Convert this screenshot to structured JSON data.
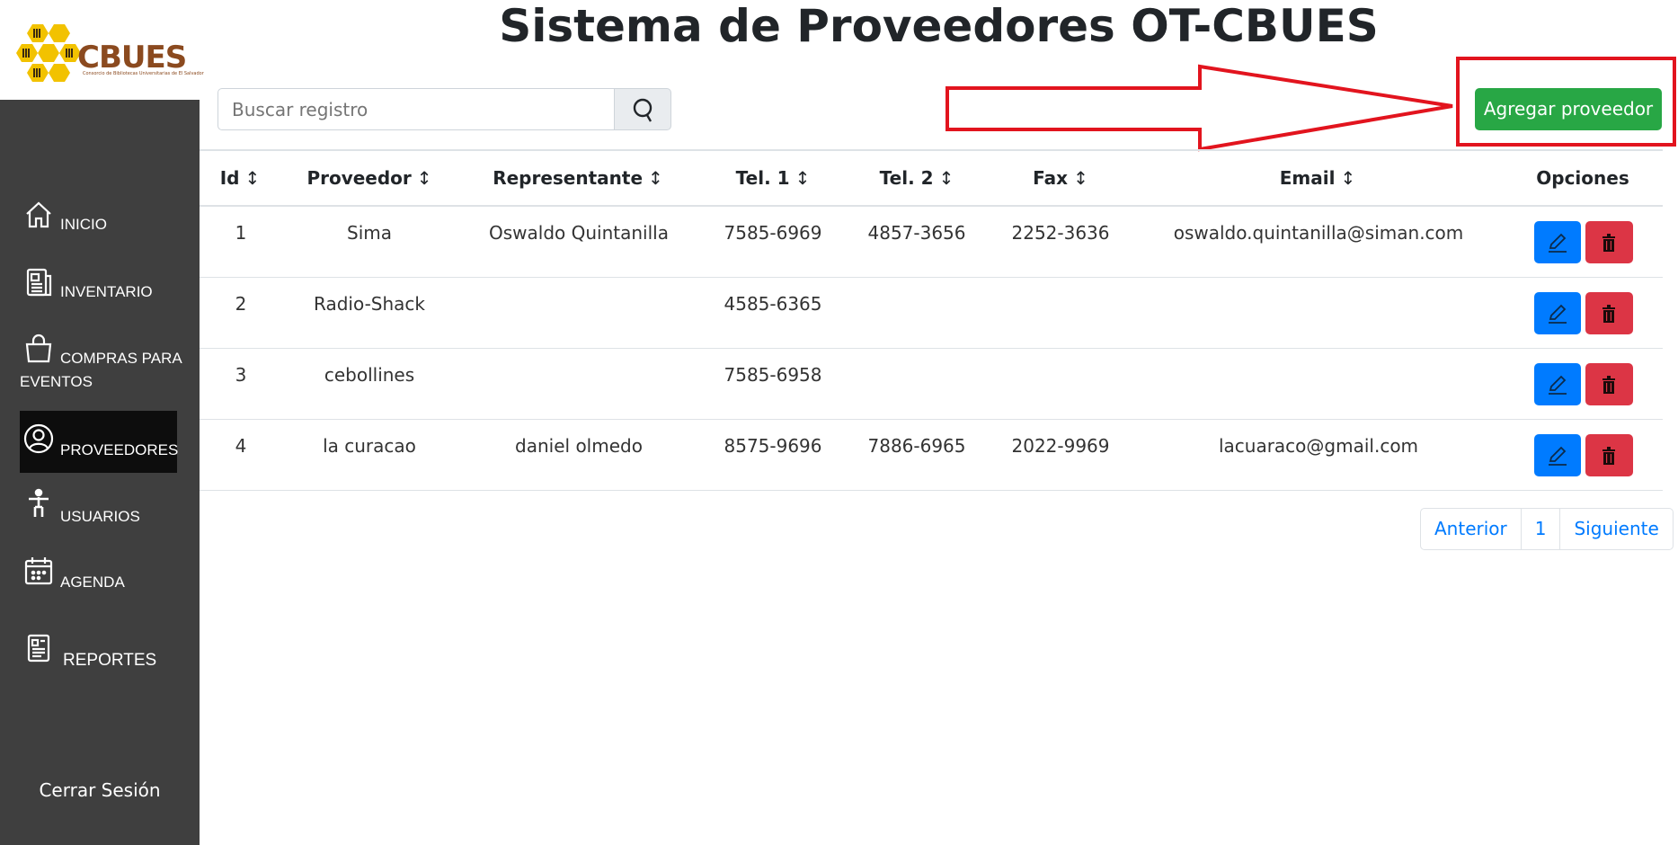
{
  "brand": {
    "logo_text": "CBUES",
    "logo_subtitle": "Consorcio de Bibliotecas Universitarias de El Salvador"
  },
  "header": {
    "title": "Sistema de Proveedores OT-CBUES"
  },
  "sidebar": {
    "items": [
      {
        "label": "INICIO",
        "icon": "home-icon"
      },
      {
        "label": "INVENTARIO",
        "icon": "newspaper-icon"
      },
      {
        "label_line1": "COMPRAS PARA",
        "label_line2": "EVENTOS",
        "icon": "shopping-bag-icon"
      },
      {
        "label": "PROVEEDORES",
        "icon": "user-circle-icon",
        "active": true
      },
      {
        "label": "USUARIOS",
        "icon": "person-icon"
      },
      {
        "label": "AGENDA",
        "icon": "calendar-icon"
      },
      {
        "label": "REPORTES",
        "icon": "report-icon"
      }
    ],
    "logout_label": "Cerrar Sesión"
  },
  "search": {
    "placeholder": "Buscar registro",
    "icon": "search-icon"
  },
  "actions": {
    "add_label": "Agregar proveedor"
  },
  "table": {
    "headers": [
      "Id",
      "Proveedor",
      "Representante",
      "Tel. 1",
      "Tel. 2",
      "Fax",
      "Email",
      "Opciones"
    ],
    "sort_glyph": "↕",
    "rows": [
      {
        "id": "1",
        "proveedor": "Sima",
        "representante": "Oswaldo Quintanilla",
        "tel1": "7585-6969",
        "tel2": "4857-3656",
        "fax": "2252-3636",
        "email": "oswaldo.quintanilla@siman.com"
      },
      {
        "id": "2",
        "proveedor": "Radio-Shack",
        "representante": "",
        "tel1": "4585-6365",
        "tel2": "",
        "fax": "",
        "email": ""
      },
      {
        "id": "3",
        "proveedor": "cebollines",
        "representante": "",
        "tel1": "7585-6958",
        "tel2": "",
        "fax": "",
        "email": ""
      },
      {
        "id": "4",
        "proveedor": "la curacao",
        "representante": "daniel olmedo",
        "tel1": "8575-9696",
        "tel2": "7886-6965",
        "fax": "2022-9969",
        "email": "lacuaraco@gmail.com"
      }
    ]
  },
  "pagination": {
    "prev": "Anterior",
    "current": "1",
    "next": "Siguiente"
  },
  "colors": {
    "sidebar_bg": "#3f3f3f",
    "active_bg": "#0d0d0d",
    "add_button": "#28a745",
    "edit_button": "#007bff",
    "delete_button": "#dc3545",
    "annotation": "#e2141e"
  }
}
